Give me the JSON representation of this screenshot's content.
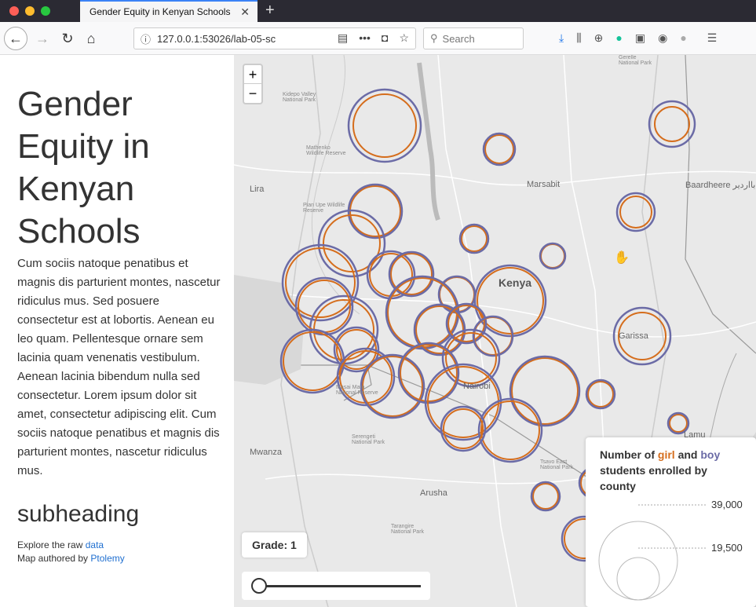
{
  "browser": {
    "tab_title": "Gender Equity in Kenyan Schools",
    "url": "127.0.0.1:53026/lab-05-sc",
    "search_placeholder": "Search"
  },
  "sidebar": {
    "title": "Gender Equity in Kenyan Schools",
    "body": "Cum sociis natoque penatibus et magnis dis parturient montes, nascetur ridiculus mus. Sed posuere consectetur est at lobortis. Aenean eu leo quam. Pellentesque ornare sem lacinia quam venenatis vestibulum. Aenean lacinia bibendum nulla sed consectetur. Lorem ipsum dolor sit amet, consectetur adipiscing elit. Cum sociis natoque penatibus et magnis dis parturient montes, nascetur ridiculus mus.",
    "subheading": "subheading",
    "explore_prefix": "Explore the raw",
    "explore_link": "data",
    "author_prefix": "Map authored by",
    "author_link": "Ptolemy"
  },
  "map": {
    "zoom_in": "+",
    "zoom_out": "−",
    "grade_label": "Grade: 1",
    "labels": {
      "kenya": "Kenya",
      "marsabit": "Marsabit",
      "lira": "Lira",
      "baardheere": "Baardheere بااردير",
      "garissa": "Garissa",
      "nairobi": "Nairobi",
      "mwanza": "Mwanza",
      "arusha": "Arusha",
      "lamu": "Lamu",
      "kidepo": "Kidepo Valley National Park",
      "mathenko": "Mathenko Wildlife Reserve",
      "pian_upe": "Pian Upe Wildlife Reserve",
      "masai_mara": "Masai Mara National Reserve",
      "serengeti": "Serengeti National Park",
      "tarangire": "Tarangire National Park",
      "tsavo": "Tsavo East National Park",
      "gerelle": "Gerelle National Park"
    },
    "colors": {
      "girl": "#d56d1c",
      "boy": "#6b6ba6"
    }
  },
  "legend": {
    "title_prefix": "Number of",
    "girl": "girl",
    "and": "and",
    "boy": "boy",
    "title_suffix": "students enrolled by county",
    "max_value": "39,000",
    "mid_value": "19,500"
  }
}
